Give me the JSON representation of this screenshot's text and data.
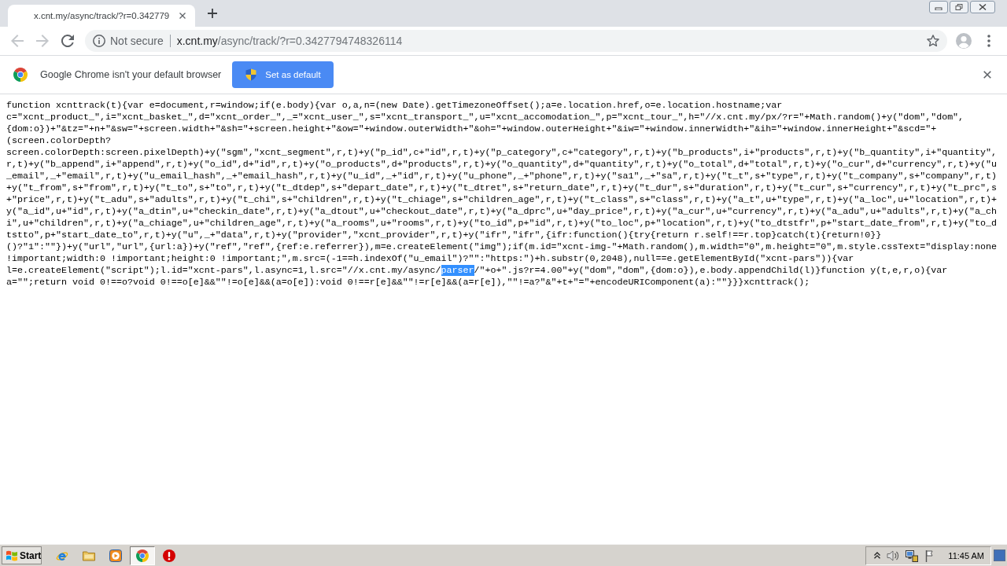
{
  "tab": {
    "title": "x.cnt.my/async/track/?r=0.342779",
    "selected": true
  },
  "nav_buttons": [
    {
      "kind": "back",
      "disabled": true
    },
    {
      "kind": "forward",
      "disabled": true
    },
    {
      "kind": "reload",
      "disabled": false
    }
  ],
  "address_bar": {
    "security_label": "Not secure",
    "host": "x.cnt.my",
    "path": "/async/track/?r=0.3427794748326114"
  },
  "infobar": {
    "message": "Google Chrome isn't your default browser",
    "button": "Set as default"
  },
  "page_text": {
    "segments": [
      {
        "text": "function xcnttrack(t){var e=document,r=window;if(e.body){var o,a,n=(new Date).getTimezoneOffset();a=e.location.href,o=e.location.hostname;var c=\"xcnt_product_\",i=\"xcnt_basket_\",d=\"xcnt_order_\",_=\"xcnt_user_\",s=\"xcnt_transport_\",u=\"xcnt_accomodation_\",p=\"xcnt_tour_\",h=\"//x.cnt.my/px/?r=\"+Math.random()+y(\"dom\",\"dom\",{dom:o})+\"&tz=\"+n+\"&sw=\"+screen.width+\"&sh=\"+screen.height+\"&ow=\"+window.outerWidth+\"&oh=\"+window.outerHeight+\"&iw=\"+window.innerWidth+\"&ih=\"+window.innerHeight+\"&scd=\"+(screen.colorDepth?screen.colorDepth:screen.pixelDepth)+y(\"sgm\",\"xcnt_segment\",r,t)+y(\"p_id\",c+\"id\",r,t)+y(\"p_category\",c+\"category\",r,t)+y(\"b_products\",i+\"products\",r,t)+y(\"b_quantity\",i+\"quantity\",r,t)+y(\"b_append\",i+\"append\",r,t)+y(\"o_id\",d+\"id\",r,t)+y(\"o_products\",d+\"products\",r,t)+y(\"o_quantity\",d+\"quantity\",r,t)+y(\"o_total\",d+\"total\",r,t)+y(\"o_cur\",d+\"currency\",r,t)+y(\"u_email\",_+\"email\",r,t)+y(\"u_email_hash\",_+\"email_hash\",r,t)+y(\"u_id\",_+\"id\",r,t)+y(\"u_phone\",_+\"phone\",r,t)+y(\"sa1\",_+\"sa\",r,t)+y(\"t_t\",s+\"type\",r,t)+y(\"t_company\",s+\"company\",r,t)+y(\"t_from\",s+\"from\",r,t)+y(\"t_to\",s+\"to\",r,t)+y(\"t_dtdep\",s+\"depart_date\",r,t)+y(\"t_dtret\",s+\"return_date\",r,t)+y(\"t_dur\",s+\"duration\",r,t)+y(\"t_cur\",s+\"currency\",r,t)+y(\"t_prc\",s+\"price\",r,t)+y(\"t_adu\",s+\"adults\",r,t)+y(\"t_chi\",s+\"children\",r,t)+y(\"t_chiage\",s+\"children_age\",r,t)+y(\"t_class\",s+\"class\",r,t)+y(\"a_t\",u+\"type\",r,t)+y(\"a_loc\",u+\"location\",r,t)+y(\"a_id\",u+\"id\",r,t)+y(\"a_dtin\",u+\"checkin_date\",r,t)+y(\"a_dtout\",u+\"checkout_date\",r,t)+y(\"a_dprc\",u+\"day_price\",r,t)+y(\"a_cur\",u+\"currency\",r,t)+y(\"a_adu\",u+\"adults\",r,t)+y(\"a_chi\",u+\"children\",r,t)+y(\"a_chiage\",u+\"children_age\",r,t)+y(\"a_rooms\",u+\"rooms\",r,t)+y(\"to_id\",p+\"id\",r,t)+y(\"to_loc\",p+\"location\",r,t)+y(\"to_dtstfr\",p+\"start_date_from\",r,t)+y(\"to_dtstto\",p+\"start_date_to\",r,t)+y(\"u\",_+\"data\",r,t)+y(\"provider\",\"xcnt_provider\",r,t)+y(\"ifr\",\"ifr\",{ifr:function(){try{return r.self!==r.top}catch(t){return!0}}()?\"1\":\"\"})+y(\"url\",\"url\",{url:a})+y(\"ref\",\"ref\",{ref:e.referrer}),m=e.createElement(\"img\");if(m.id=\"xcnt-img-\"+Math.random(),m.width=\"0\",m.height=\"0\",m.style.cssText=\"display:none !important;width:0 !important;height:0 !important;\",m.src=(-1==h.indexOf(\"u_email\")?\"\":\"https:\")+h.substr(0,2048),null==e.getElementById(\"xcnt-pars\")){var l=e.createElement(\"script\");l.id=\"xcnt-pars\",l.async=1,l.src=\"//x.cnt.my/async/",
        "selected": false
      },
      {
        "text": "parser",
        "selected": true
      },
      {
        "text": "/\"+o+\".js?r=4.00\"+y(\"dom\",\"dom\",{dom:o}),e.body.appendChild(l)}function y(t,e,r,o){var a=\"\";return void 0!==o?void 0!==o[e]&&\"\"!=o[e]&&(a=o[e]):void 0!==r[e]&&\"\"!=r[e]&&(a=r[e]),\"\"!=a?\"&\"+t+\"=\"+encodeURIComponent(a):\"\"}}}xcnttrack();",
        "selected": false
      }
    ]
  },
  "taskbar": {
    "start_label": "Start",
    "apps": [
      {
        "kind": "ie",
        "selected": false
      },
      {
        "kind": "folder",
        "selected": false
      },
      {
        "kind": "media",
        "selected": false
      },
      {
        "kind": "chrome",
        "selected": true
      },
      {
        "kind": "alert",
        "selected": false
      }
    ],
    "clock": "11:45 AM"
  }
}
